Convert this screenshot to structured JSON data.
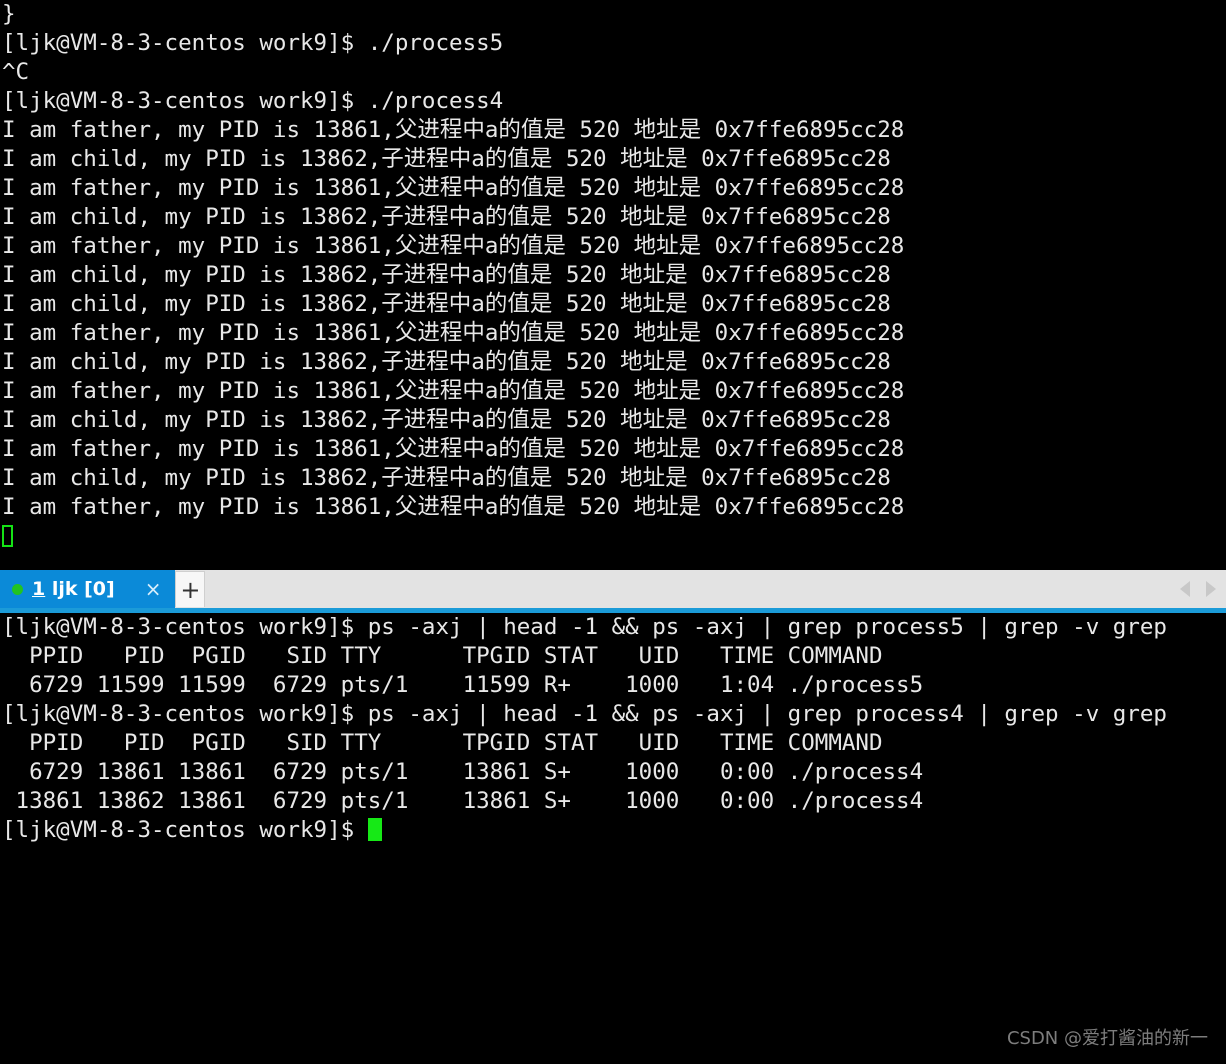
{
  "window": {
    "background_color": "#000000",
    "foreground_color": "#e8e8e8",
    "cursor_color": "#16e916"
  },
  "top_pane": {
    "lines": [
      "}",
      "[ljk@VM-8-3-centos work9]$ ./process5",
      "^C",
      "[ljk@VM-8-3-centos work9]$ ./process4",
      "I am father, my PID is 13861,父进程中a的值是 520 地址是 0x7ffe6895cc28",
      "I am child, my PID is 13862,子进程中a的值是 520 地址是 0x7ffe6895cc28",
      "I am father, my PID is 13861,父进程中a的值是 520 地址是 0x7ffe6895cc28",
      "I am child, my PID is 13862,子进程中a的值是 520 地址是 0x7ffe6895cc28",
      "I am father, my PID is 13861,父进程中a的值是 520 地址是 0x7ffe6895cc28",
      "I am child, my PID is 13862,子进程中a的值是 520 地址是 0x7ffe6895cc28",
      "I am child, my PID is 13862,子进程中a的值是 520 地址是 0x7ffe6895cc28",
      "I am father, my PID is 13861,父进程中a的值是 520 地址是 0x7ffe6895cc28",
      "I am child, my PID is 13862,子进程中a的值是 520 地址是 0x7ffe6895cc28",
      "I am father, my PID is 13861,父进程中a的值是 520 地址是 0x7ffe6895cc28",
      "I am child, my PID is 13862,子进程中a的值是 520 地址是 0x7ffe6895cc28",
      "I am father, my PID is 13861,父进程中a的值是 520 地址是 0x7ffe6895cc28",
      "I am child, my PID is 13862,子进程中a的值是 520 地址是 0x7ffe6895cc28",
      "I am father, my PID is 13861,父进程中a的值是 520 地址是 0x7ffe6895cc28"
    ],
    "cursor_style": "hollow-block"
  },
  "tabbar": {
    "tab": {
      "status_dot_color": "#22c322",
      "index_label": "1",
      "name_label": " ljk [0]",
      "close_label": "×"
    },
    "new_tab_label": "+",
    "scroll_left_label": "scroll-left",
    "scroll_right_label": "scroll-right",
    "active_color": "#0b8ad8",
    "underline_color": "#1b9bd8"
  },
  "bottom_pane": {
    "lines": [
      "[ljk@VM-8-3-centos work9]$ ps -axj | head -1 && ps -axj | grep process5 | grep -v grep",
      "  PPID   PID  PGID   SID TTY      TPGID STAT   UID   TIME COMMAND",
      "  6729 11599 11599  6729 pts/1    11599 R+    1000   1:04 ./process5",
      "[ljk@VM-8-3-centos work9]$ ps -axj | head -1 && ps -axj | grep process4 | grep -v grep",
      "  PPID   PID  PGID   SID TTY      TPGID STAT   UID   TIME COMMAND",
      "  6729 13861 13861  6729 pts/1    13861 S+    1000   0:00 ./process4",
      " 13861 13862 13861  6729 pts/1    13861 S+    1000   0:00 ./process4"
    ],
    "prompt": "[ljk@VM-8-3-centos work9]$ ",
    "cursor_style": "filled-block"
  },
  "watermark": {
    "text": "CSDN @爱打酱油的新一"
  }
}
